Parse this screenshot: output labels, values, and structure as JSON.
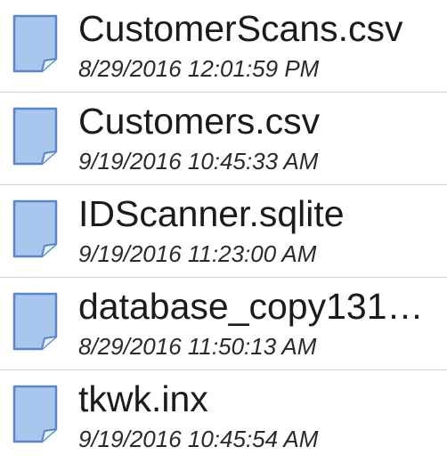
{
  "colors": {
    "icon_fill": "#a8c6ee",
    "icon_stroke": "#5b86c3",
    "text_primary": "#1b1b1b",
    "divider": "#d4d4d4"
  },
  "files": [
    {
      "icon": "document-icon",
      "name": "CustomerScans.csv",
      "date": "8/29/2016 12:01:59 PM"
    },
    {
      "icon": "document-icon",
      "name": "Customers.csv",
      "date": "9/19/2016 10:45:33 AM"
    },
    {
      "icon": "document-icon",
      "name": "IDScanner.sqlite",
      "date": "9/19/2016 11:23:00 AM"
    },
    {
      "icon": "document-icon",
      "name": "database_copy131…",
      "date": "8/29/2016 11:50:13 AM"
    },
    {
      "icon": "document-icon",
      "name": "tkwk.inx",
      "date": "9/19/2016 10:45:54 AM"
    }
  ]
}
